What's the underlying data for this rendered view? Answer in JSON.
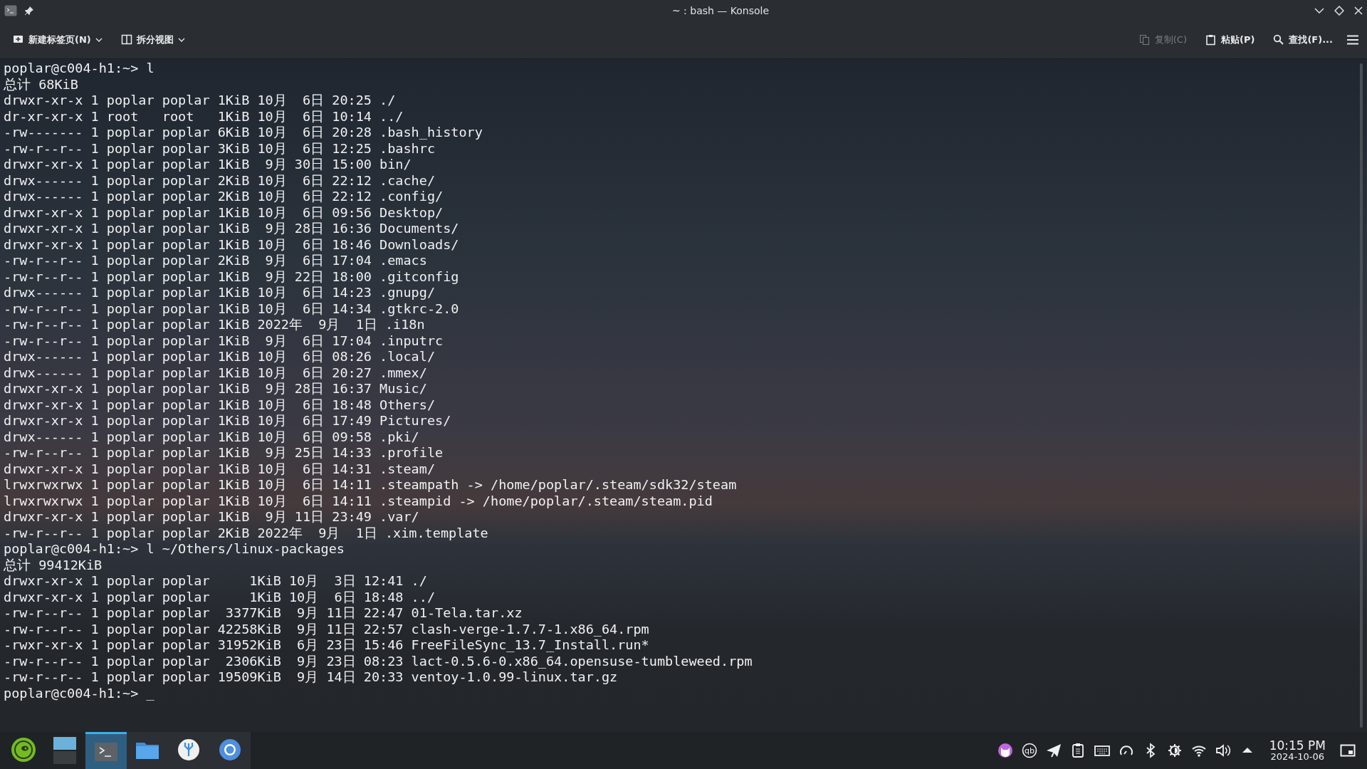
{
  "window": {
    "title": "~ : bash — Konsole"
  },
  "toolbar": {
    "left": [
      {
        "kind": "new-tab",
        "label": "新建标签页(N)",
        "has_menu": true
      },
      {
        "kind": "split",
        "label": "拆分视图",
        "has_menu": true
      }
    ],
    "right": [
      {
        "kind": "copy",
        "label": "复制(C)",
        "disabled": true
      },
      {
        "kind": "paste",
        "label": "粘贴(P)",
        "disabled": false
      },
      {
        "kind": "find",
        "label": "查找(F)...",
        "disabled": false
      }
    ]
  },
  "terminal": {
    "lines": [
      "poplar@c004-h1:~> l",
      "总计 68KiB",
      "drwxr-xr-x 1 poplar poplar 1KiB 10月  6日 20:25 ./",
      "dr-xr-xr-x 1 root   root   1KiB 10月  6日 10:14 ../",
      "-rw------- 1 poplar poplar 6KiB 10月  6日 20:28 .bash_history",
      "-rw-r--r-- 1 poplar poplar 3KiB 10月  6日 12:25 .bashrc",
      "drwxr-xr-x 1 poplar poplar 1KiB  9月 30日 15:00 bin/",
      "drwx------ 1 poplar poplar 2KiB 10月  6日 22:12 .cache/",
      "drwx------ 1 poplar poplar 2KiB 10月  6日 22:12 .config/",
      "drwxr-xr-x 1 poplar poplar 1KiB 10月  6日 09:56 Desktop/",
      "drwxr-xr-x 1 poplar poplar 1KiB  9月 28日 16:36 Documents/",
      "drwxr-xr-x 1 poplar poplar 1KiB 10月  6日 18:46 Downloads/",
      "-rw-r--r-- 1 poplar poplar 2KiB  9月  6日 17:04 .emacs",
      "-rw-r--r-- 1 poplar poplar 1KiB  9月 22日 18:00 .gitconfig",
      "drwx------ 1 poplar poplar 1KiB 10月  6日 14:23 .gnupg/",
      "-rw-r--r-- 1 poplar poplar 1KiB 10月  6日 14:34 .gtkrc-2.0",
      "-rw-r--r-- 1 poplar poplar 1KiB 2022年  9月  1日 .i18n",
      "-rw-r--r-- 1 poplar poplar 1KiB  9月  6日 17:04 .inputrc",
      "drwx------ 1 poplar poplar 1KiB 10月  6日 08:26 .local/",
      "drwx------ 1 poplar poplar 1KiB 10月  6日 20:27 .mmex/",
      "drwxr-xr-x 1 poplar poplar 1KiB  9月 28日 16:37 Music/",
      "drwxr-xr-x 1 poplar poplar 1KiB 10月  6日 18:48 Others/",
      "drwxr-xr-x 1 poplar poplar 1KiB 10月  6日 17:49 Pictures/",
      "drwx------ 1 poplar poplar 1KiB 10月  6日 09:58 .pki/",
      "-rw-r--r-- 1 poplar poplar 1KiB  9月 25日 14:33 .profile",
      "drwxr-xr-x 1 poplar poplar 1KiB 10月  6日 14:31 .steam/",
      "lrwxrwxrwx 1 poplar poplar 1KiB 10月  6日 14:11 .steampath -> /home/poplar/.steam/sdk32/steam",
      "lrwxrwxrwx 1 poplar poplar 1KiB 10月  6日 14:11 .steampid -> /home/poplar/.steam/steam.pid",
      "drwxr-xr-x 1 poplar poplar 1KiB  9月 11日 23:49 .var/",
      "-rw-r--r-- 1 poplar poplar 2KiB 2022年  9月  1日 .xim.template",
      "poplar@c004-h1:~> l ~/Others/linux-packages",
      "总计 99412KiB",
      "drwxr-xr-x 1 poplar poplar     1KiB 10月  3日 12:41 ./",
      "drwxr-xr-x 1 poplar poplar     1KiB 10月  6日 18:48 ../",
      "-rw-r--r-- 1 poplar poplar  3377KiB  9月 11日 22:47 01-Tela.tar.xz",
      "-rw-r--r-- 1 poplar poplar 42258KiB  9月 11日 22:57 clash-verge-1.7.7-1.x86_64.rpm",
      "-rwxr-xr-x 1 poplar poplar 31952KiB  6月 23日 15:46 FreeFileSync_13.7_Install.run*",
      "-rw-r--r-- 1 poplar poplar  2306KiB  9月 23日 08:23 lact-0.5.6-0.x86_64.opensuse-tumbleweed.rpm",
      "-rw-r--r-- 1 poplar poplar 19509KiB  9月 14日 20:33 ventoy-1.0.99-linux.tar.gz",
      "poplar@c004-h1:~> _"
    ]
  },
  "taskbar": {
    "apps": [
      {
        "kind": "launcher",
        "active": false
      },
      {
        "kind": "pager",
        "active": false
      },
      {
        "kind": "terminal",
        "active": true
      },
      {
        "kind": "files",
        "active": false
      },
      {
        "kind": "vscodium",
        "active": false
      },
      {
        "kind": "browser",
        "active": false
      }
    ],
    "tray": [
      {
        "kind": "cat"
      },
      {
        "kind": "qb",
        "text": "qb"
      },
      {
        "kind": "send"
      },
      {
        "kind": "clipboard"
      },
      {
        "kind": "keyboard"
      },
      {
        "kind": "gauge"
      },
      {
        "kind": "bluetooth"
      },
      {
        "kind": "brightness"
      },
      {
        "kind": "wifi"
      },
      {
        "kind": "volume"
      },
      {
        "kind": "expand"
      }
    ],
    "clock": {
      "time": "10:15 PM",
      "date": "2024-10-06"
    }
  }
}
